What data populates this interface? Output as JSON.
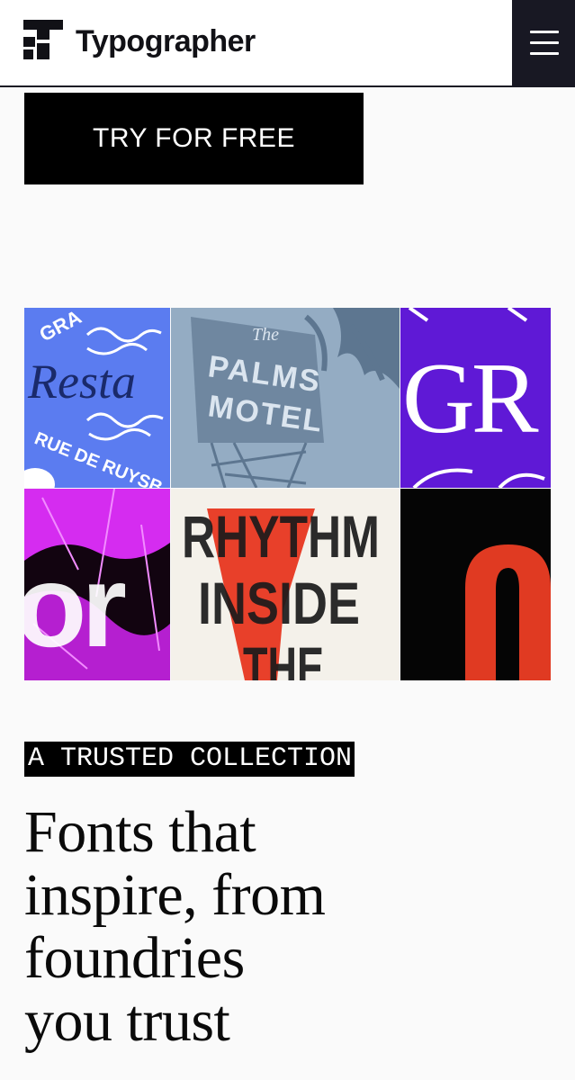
{
  "header": {
    "brand_name": "Typographer",
    "logo_icon": "typographer-logo-icon",
    "menu_icon": "hamburger-menu-icon"
  },
  "cta": {
    "label": "TRY FOR FREE"
  },
  "font_gallery": {
    "tiles": [
      {
        "lines": [
          "GRA",
          "Resta",
          "RUE DE RUYSB"
        ],
        "colors": [
          "#5b7cf0",
          "#1a2a6b"
        ]
      },
      {
        "lines": [
          "The",
          "PALMS",
          "MOTEL"
        ],
        "colors": [
          "#8ea6bf",
          "#5d7690"
        ]
      },
      {
        "lines": [
          "GR"
        ],
        "colors": [
          "#5f19d6",
          "#ffffff"
        ]
      },
      {
        "lines": [
          "or"
        ],
        "colors": [
          "#d52cf0",
          "#120410"
        ]
      },
      {
        "lines": [
          "RHYTHM",
          "INSIDE",
          "THE"
        ],
        "colors": [
          "#f4f1ea",
          "#e8402a"
        ]
      },
      {
        "lines": [
          "n"
        ],
        "colors": [
          "#050505",
          "#e03a22"
        ]
      }
    ]
  },
  "section": {
    "eyebrow": "A TRUSTED COLLECTION",
    "headline_lines": [
      "Fonts that",
      "inspire, from",
      "foundries",
      "you trust"
    ]
  },
  "colors": {
    "background": "#fafafa",
    "header_bg": "#ffffff",
    "menu_bg": "#181823",
    "cta_bg": "#000000",
    "text": "#0a0a0a"
  }
}
